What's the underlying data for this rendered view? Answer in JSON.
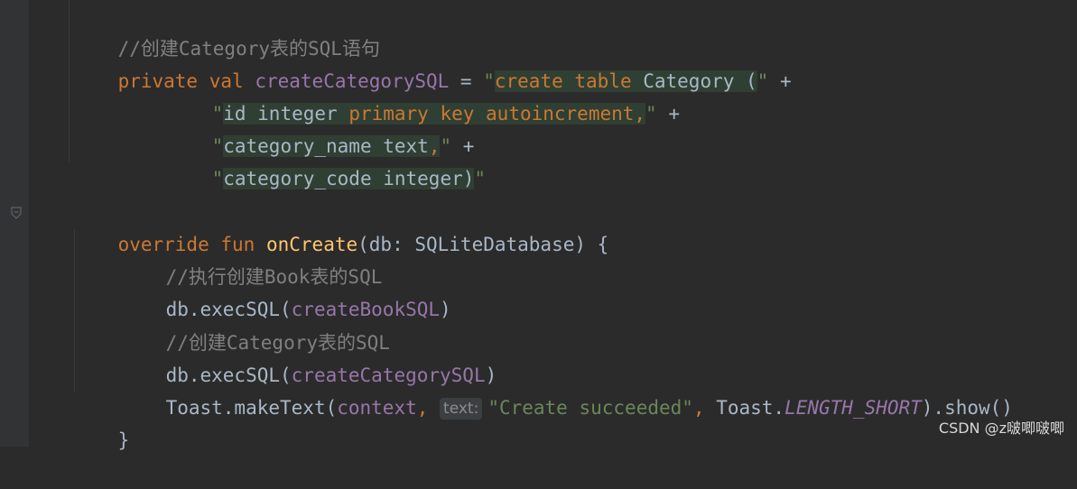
{
  "colors": {
    "background": "#2b2b2b",
    "comment": "#808080",
    "keyword": "#cc7832",
    "property": "#9876aa",
    "plain": "#a9b7c6",
    "string": "#6a8759",
    "function": "#ffc66d",
    "injection_bg": "#2f3f33"
  },
  "code": {
    "comment_1": "//创建Category表的SQL语句",
    "line_2": {
      "private": "private",
      "val": "val",
      "name": "createCategorySQL",
      "eq": " = ",
      "q_open": "\"",
      "sql_kw": "create table",
      "sql_rest": " Category (",
      "q_close": "\"",
      "plus": " +"
    },
    "line_3": {
      "q_open": "\"",
      "sql_a": "id integer ",
      "sql_kw": "primary key autoincrement,",
      "q_close": "\"",
      "plus": " +"
    },
    "line_4": {
      "q_open": "\"",
      "sql_a": "category_name text",
      "sql_kw": ",",
      "q_close": "\"",
      "plus": " +"
    },
    "line_5": {
      "q_open": "\"",
      "sql_a": "category_code integer)",
      "q_close": "\""
    },
    "line_7": {
      "override": "override",
      "fun": "fun",
      "fn_name": "onCreate",
      "params": "(db: SQLiteDatabase) {"
    },
    "comment_8": "//执行创建Book表的SQL",
    "line_9": {
      "call": "db.execSQL(",
      "arg": "createBookSQL",
      "close": ")"
    },
    "comment_10": "//创建Category表的SQL",
    "line_11": {
      "call": "db.execSQL(",
      "arg": "createCategorySQL",
      "close": ")"
    },
    "line_12": {
      "call": "Toast.makeText(",
      "arg_context": "context",
      "comma": ", ",
      "hint": "text:",
      "str": "\"Create succeeded\"",
      "comma2": ", ",
      "toast": "Toast.",
      "const": "LENGTH_SHORT",
      "end": ").show()"
    },
    "line_13": "}"
  },
  "watermark": "CSDN @z啵唧啵唧"
}
